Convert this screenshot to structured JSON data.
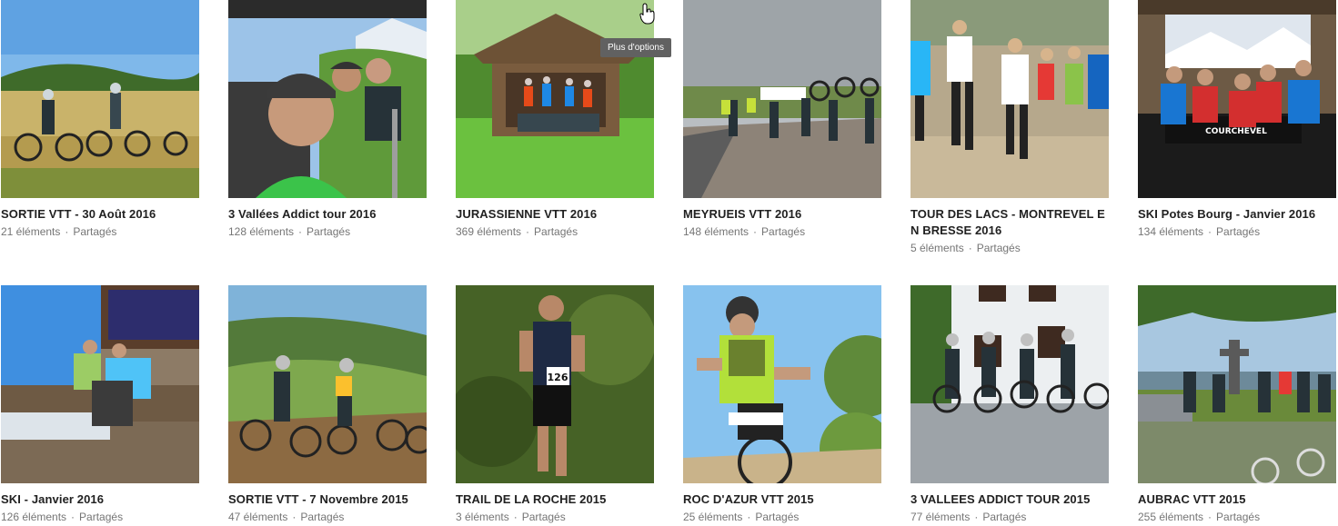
{
  "tooltip": "Plus d'options",
  "shared_label": "Partagés",
  "albums": [
    {
      "title": "SORTIE VTT - 30 Août 2016",
      "count": "21 éléments",
      "scene": "meadow-bikes"
    },
    {
      "title": "3 Vallées Addict tour 2016",
      "count": "128 éléments",
      "scene": "chairlift-selfie"
    },
    {
      "title": "JURASSIENNE VTT 2016",
      "count": "369 éléments",
      "scene": "hut-group"
    },
    {
      "title": "MEYRUEIS VTT 2016",
      "count": "148 éléments",
      "scene": "road-group-bikes"
    },
    {
      "title": "TOUR DES LACS - MONTREVEL EN BRESSE 2016",
      "count": "5 éléments",
      "scene": "runners-race"
    },
    {
      "title": "SKI Potes Bourg - Janvier 2016",
      "count": "134 éléments",
      "scene": "ski-group-sign"
    },
    {
      "title": "SKI - Janvier 2016",
      "count": "126 éléments",
      "scene": "ski-cabin-terrace"
    },
    {
      "title": "SORTIE VTT - 7 Novembre 2015",
      "count": "47 éléments",
      "scene": "hill-bikers"
    },
    {
      "title": "TRAIL DE LA ROCHE 2015",
      "count": "3 éléments",
      "scene": "trail-runner"
    },
    {
      "title": "ROC D'AZUR VTT 2015",
      "count": "25 éléments",
      "scene": "mtb-racer"
    },
    {
      "title": "3 VALLEES ADDICT TOUR 2015",
      "count": "77 éléments",
      "scene": "house-bikers"
    },
    {
      "title": "AUBRAC VTT 2015",
      "count": "255 éléments",
      "scene": "cross-bikers"
    }
  ]
}
